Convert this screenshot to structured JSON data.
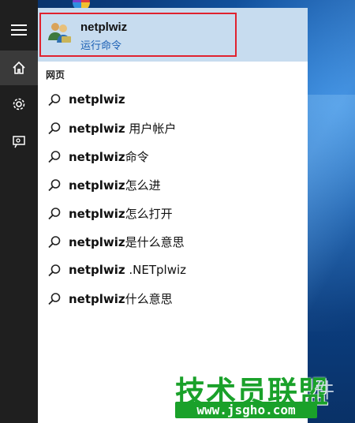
{
  "best_match": {
    "title": "netplwiz",
    "subtitle": "运行命令"
  },
  "section": {
    "label": "网页"
  },
  "results": [
    {
      "bold": "netplwiz",
      "rest": ""
    },
    {
      "bold": "netplwiz",
      "rest": " 用户帐户"
    },
    {
      "bold": "netplwiz",
      "rest": "命令"
    },
    {
      "bold": "netplwiz",
      "rest": "怎么进"
    },
    {
      "bold": "netplwiz",
      "rest": "怎么打开"
    },
    {
      "bold": "netplwiz",
      "rest": "是什么意思"
    },
    {
      "bold": "netplwiz",
      "rest": " .NETplwiz"
    },
    {
      "bold": "netplwiz",
      "rest": "什么意思"
    }
  ],
  "rail": {
    "items": [
      {
        "icon": "hamburger-menu-icon"
      },
      {
        "icon": "home-icon",
        "active": true
      },
      {
        "icon": "gear-icon"
      },
      {
        "icon": "feedback-icon"
      }
    ]
  },
  "watermark": {
    "brand": "技术员联盟",
    "suffix": "件",
    "url": "www.jsgho.com"
  },
  "colors": {
    "best_match_bg": "#c7dcef",
    "highlight_border": "#e0222f",
    "subtitle": "#1a5fb4",
    "rail_bg": "#1f1f1f",
    "watermark_green": "#1aa12a"
  }
}
